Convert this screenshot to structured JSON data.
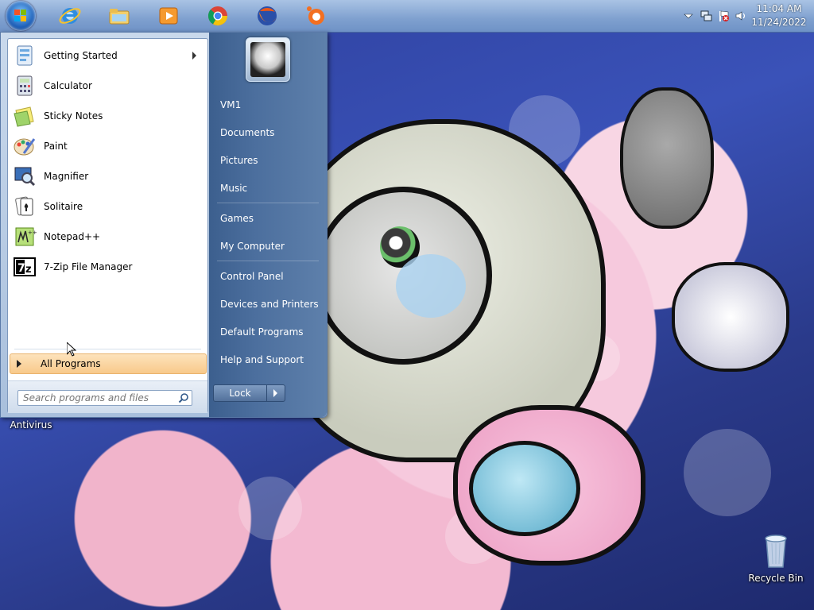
{
  "taskbar": {
    "pinned": [
      {
        "icon": "internet-explorer-icon"
      },
      {
        "icon": "file-explorer-icon"
      },
      {
        "icon": "media-player-icon"
      },
      {
        "icon": "chrome-icon"
      },
      {
        "icon": "firefox-icon"
      },
      {
        "icon": "avast-icon"
      }
    ],
    "tray": {
      "icons": [
        "show-hidden-icons-icon",
        "network-icon",
        "action-center-flag-icon",
        "volume-icon"
      ],
      "time": "11:04 AM",
      "date": "11/24/2022"
    }
  },
  "start_menu": {
    "programs": [
      {
        "label": "Getting Started",
        "icon": "getting-started-icon",
        "has_submenu": true
      },
      {
        "label": "Calculator",
        "icon": "calculator-icon"
      },
      {
        "label": "Sticky Notes",
        "icon": "sticky-notes-icon"
      },
      {
        "label": "Paint",
        "icon": "paint-icon"
      },
      {
        "label": "Magnifier",
        "icon": "magnifier-icon"
      },
      {
        "label": "Solitaire",
        "icon": "solitaire-icon"
      },
      {
        "label": "Notepad++",
        "icon": "notepadpp-icon"
      },
      {
        "label": "7-Zip File Manager",
        "icon": "7zip-icon"
      }
    ],
    "all_programs_label": "All Programs",
    "search_placeholder": "Search programs and files",
    "places": [
      "VM1",
      "Documents",
      "Pictures",
      "Music",
      "Games",
      "My Computer",
      "Control Panel",
      "Devices and Printers",
      "Default Programs",
      "Help and Support"
    ],
    "lock_label": "Lock"
  },
  "desktop": {
    "icons": [
      {
        "label": "Antivirus",
        "icon": "antivirus-icon"
      },
      {
        "label": "Recycle Bin",
        "icon": "recycle-bin-icon"
      }
    ]
  },
  "colors": {
    "taskbar": "#8aa8d4",
    "all_programs_highlight": "#f8c98a",
    "right_pane": "#4c6f9e"
  }
}
